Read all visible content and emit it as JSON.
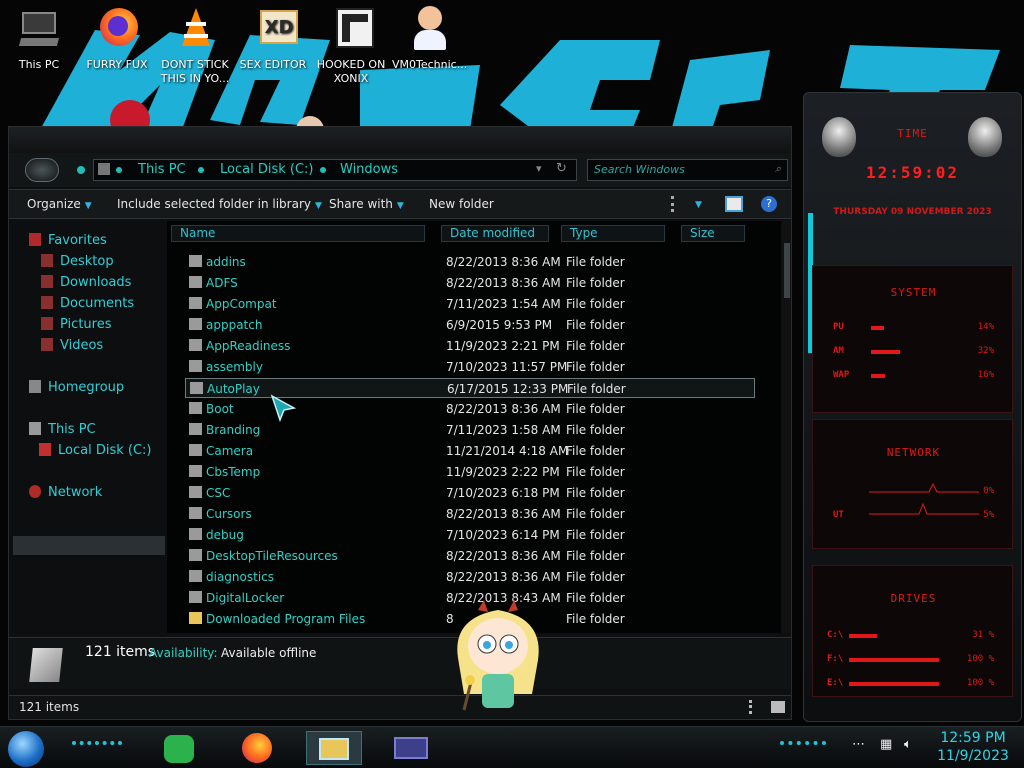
{
  "desktop": {
    "icons": [
      {
        "label": "This PC",
        "icon": "computer-icon"
      },
      {
        "label": "FURRY FUX",
        "icon": "firefox-icon"
      },
      {
        "label": "DONT STICK THIS IN YO...",
        "icon": "vlc-icon"
      },
      {
        "label": "SEX EDITOR",
        "icon": "adobe-xd-icon"
      },
      {
        "label": "HOOKED ON XONIX",
        "icon": "game-icon"
      },
      {
        "label": "VM0Technic...",
        "icon": "doctor-icon"
      }
    ]
  },
  "explorer": {
    "breadcrumb": [
      "This PC",
      "Local Disk (C:)",
      "Windows"
    ],
    "search_placeholder": "Search Windows",
    "toolbar": {
      "organize": "Organize",
      "include": "Include selected folder in library",
      "share": "Share with",
      "new_folder": "New folder"
    },
    "nav": {
      "favorites": "Favorites",
      "desktop": "Desktop",
      "downloads": "Downloads",
      "documents": "Documents",
      "pictures": "Pictures",
      "videos": "Videos",
      "homegroup": "Homegroup",
      "this_pc": "This PC",
      "local_disk": "Local Disk (C:)",
      "network": "Network"
    },
    "columns": {
      "name": "Name",
      "date": "Date modified",
      "type": "Type",
      "size": "Size"
    },
    "files": [
      {
        "name": "addins",
        "date": "8/22/2013 8:36 AM",
        "type": "File folder"
      },
      {
        "name": "ADFS",
        "date": "8/22/2013 8:36 AM",
        "type": "File folder"
      },
      {
        "name": "AppCompat",
        "date": "7/11/2023 1:54 AM",
        "type": "File folder"
      },
      {
        "name": "apppatch",
        "date": "6/9/2015 9:53 PM",
        "type": "File folder"
      },
      {
        "name": "AppReadiness",
        "date": "11/9/2023 2:21 PM",
        "type": "File folder"
      },
      {
        "name": "assembly",
        "date": "7/10/2023 11:57 PM",
        "type": "File folder"
      },
      {
        "name": "AutoPlay",
        "date": "6/17/2015 12:33 PM",
        "type": "File folder"
      },
      {
        "name": "Boot",
        "date": "8/22/2013 8:36 AM",
        "type": "File folder"
      },
      {
        "name": "Branding",
        "date": "7/11/2023 1:58 AM",
        "type": "File folder"
      },
      {
        "name": "Camera",
        "date": "11/21/2014 4:18 AM",
        "type": "File folder"
      },
      {
        "name": "CbsTemp",
        "date": "11/9/2023 2:22 PM",
        "type": "File folder"
      },
      {
        "name": "CSC",
        "date": "7/10/2023 6:18 PM",
        "type": "File folder"
      },
      {
        "name": "Cursors",
        "date": "8/22/2013 8:36 AM",
        "type": "File folder"
      },
      {
        "name": "debug",
        "date": "7/10/2023 6:14 PM",
        "type": "File folder"
      },
      {
        "name": "DesktopTileResources",
        "date": "8/22/2013 8:36 AM",
        "type": "File folder"
      },
      {
        "name": "diagnostics",
        "date": "8/22/2013 8:36 AM",
        "type": "File folder"
      },
      {
        "name": "DigitalLocker",
        "date": "8/22/2013 8:43 AM",
        "type": "File folder"
      },
      {
        "name": "Downloaded Program Files",
        "date": "8",
        "type": "File folder"
      }
    ],
    "selected_file": "AutoPlay",
    "details": {
      "count": "121 items",
      "availability_label": "Availability:",
      "availability_value": "Available offline"
    },
    "status": "121 items"
  },
  "gadget": {
    "time_title": "TIME",
    "time": "12:59:02",
    "date": "THURSDAY 09 NOVEMBER 2023",
    "system_title": "SYSTEM",
    "cpu_label": "PU",
    "cpu_value": "14%",
    "cpu_level": 0.14,
    "ram_label": "AM",
    "ram_value": "32%",
    "ram_level": 0.32,
    "swap_label": "WAP",
    "swap_value": "16%",
    "swap_level": 0.16,
    "network_title": "NETWORK",
    "net_in_value": "0%",
    "net_out_label": "UT",
    "net_out_value": "5%",
    "drives_title": "DRIVES",
    "drives": [
      {
        "label": "C:\\",
        "value": "31 %",
        "level": 0.31
      },
      {
        "label": "F:\\",
        "value": "100 %",
        "level": 1.0
      },
      {
        "label": "E:\\",
        "value": "100 %",
        "level": 1.0
      }
    ]
  },
  "taskbar": {
    "time": "12:59 PM",
    "date": "11/9/2023"
  }
}
